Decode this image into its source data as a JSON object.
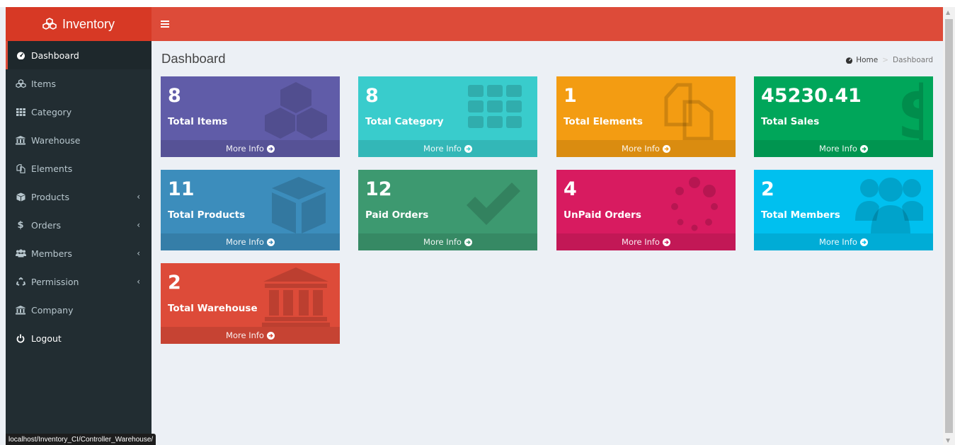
{
  "app": {
    "brand": "Inventory"
  },
  "sidebar": {
    "items": [
      {
        "label": "Dashboard",
        "icon": "dashboard-icon",
        "active": true
      },
      {
        "label": "Items",
        "icon": "cubes-icon"
      },
      {
        "label": "Category",
        "icon": "grid-icon"
      },
      {
        "label": "Warehouse",
        "icon": "bank-icon"
      },
      {
        "label": "Elements",
        "icon": "copy-icon"
      },
      {
        "label": "Products",
        "icon": "cube-icon",
        "submenu": true
      },
      {
        "label": "Orders",
        "icon": "dollar-icon",
        "submenu": true
      },
      {
        "label": "Members",
        "icon": "users-icon",
        "submenu": true
      },
      {
        "label": "Permission",
        "icon": "recycle-icon",
        "submenu": true
      },
      {
        "label": "Company",
        "icon": "bank-icon"
      },
      {
        "label": "Logout",
        "icon": "power-icon"
      }
    ]
  },
  "header": {
    "title": "Dashboard"
  },
  "breadcrumb": {
    "home": "Home",
    "current": "Dashboard"
  },
  "cards": [
    {
      "value": "8",
      "label": "Total Items",
      "color": "#605ca8",
      "icon": "cubes-icon",
      "footer": "More Info"
    },
    {
      "value": "8",
      "label": "Total Category",
      "color": "#39cccc",
      "icon": "grid-icon",
      "footer": "More Info"
    },
    {
      "value": "1",
      "label": "Total Elements",
      "color": "#f39c12",
      "icon": "copy-icon",
      "footer": "More Info"
    },
    {
      "value": "45230.41",
      "label": "Total Sales",
      "color": "#00a65a",
      "icon": "dollar-icon",
      "footer": "More Info"
    },
    {
      "value": "11",
      "label": "Total Products",
      "color": "#3c8dbc",
      "icon": "cube-icon",
      "footer": "More Info"
    },
    {
      "value": "12",
      "label": "Paid Orders",
      "color": "#3d9970",
      "icon": "check-icon",
      "footer": "More Info"
    },
    {
      "value": "4",
      "label": "UnPaid Orders",
      "color": "#d81b60",
      "icon": "spinner-icon",
      "footer": "More Info"
    },
    {
      "value": "2",
      "label": "Total Members",
      "color": "#00c0ef",
      "icon": "users-icon",
      "footer": "More Info"
    },
    {
      "value": "2",
      "label": "Total Warehouse",
      "color": "#dd4b39",
      "icon": "bank-icon",
      "footer": "More Info"
    }
  ],
  "statusbar": {
    "url": "localhost/Inventory_CI/Controller_Warehouse/"
  },
  "colors": {
    "navbar": "#dd4b39",
    "logo": "#d73925",
    "sidebar": "#222d32",
    "content": "#ecf0f5"
  }
}
